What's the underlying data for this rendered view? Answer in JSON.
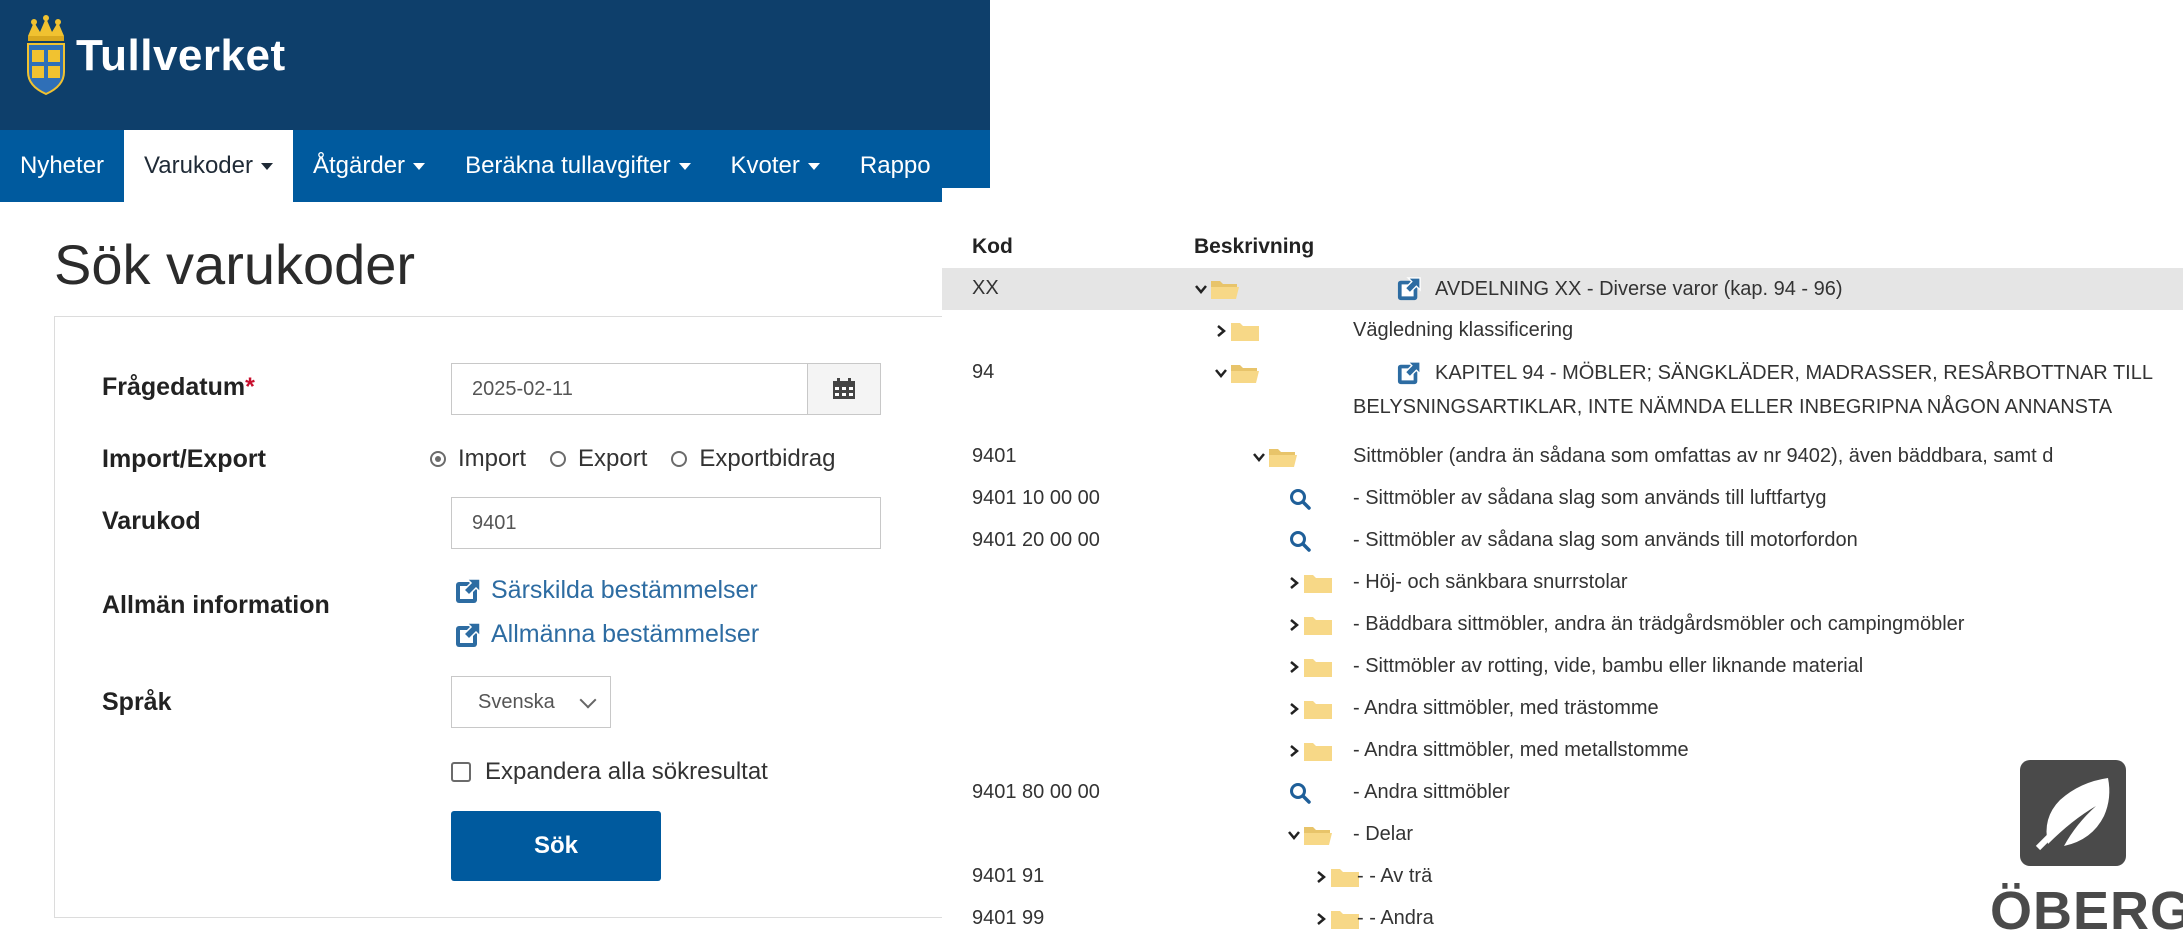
{
  "site": {
    "brand": "Tullverket",
    "nav": [
      {
        "label": "Nyheter",
        "dropdown": false,
        "active": false
      },
      {
        "label": "Varukoder",
        "dropdown": true,
        "active": true
      },
      {
        "label": "Åtgärder",
        "dropdown": true,
        "active": false
      },
      {
        "label": "Beräkna tullavgifter",
        "dropdown": true,
        "active": false
      },
      {
        "label": "Kvoter",
        "dropdown": true,
        "active": false
      },
      {
        "label": "Rappo",
        "dropdown": false,
        "active": false
      }
    ],
    "colors": {
      "header": "#0e3f6b",
      "nav": "#005a9e",
      "link": "#2d6ca2",
      "required": "#c8102e"
    }
  },
  "page": {
    "title": "Sök varukoder"
  },
  "form": {
    "date_label": "Frågedatum",
    "required_mark": "*",
    "date_value": "2025-02-11",
    "ie_label": "Import/Export",
    "ie_options": [
      "Import",
      "Export",
      "Exportbidrag"
    ],
    "ie_selected": "Import",
    "code_label": "Varukod",
    "code_value": "9401",
    "info_label": "Allmän information",
    "links": [
      "Särskilda bestämmelser",
      "Allmänna bestämmelser"
    ],
    "lang_label": "Språk",
    "lang_value": "Svenska",
    "expand_label": "Expandera alla sökresultat",
    "expand_checked": false,
    "search_button": "Sök"
  },
  "results": {
    "headers": {
      "code": "Kod",
      "desc": "Beskrivning"
    },
    "rows": [
      {
        "code": "XX",
        "icon": "folder-open",
        "desc": "AVDELNING XX - Diverse varor (kap. 94 - 96)",
        "ext": true
      },
      {
        "code": "",
        "icon": "folder-closed",
        "desc": "Vägledning klassificering",
        "ext": false
      },
      {
        "code": "94",
        "icon": "folder-open",
        "desc": "KAPITEL 94 - MÖBLER; SÄNGKLÄDER, MADRASSER, RESÅRBOTTNAR TILL",
        "desc2": "BELYSNINGSARTIKLAR, INTE NÄMNDA ELLER INBEGRIPNA NÅGON ANNANSTA",
        "ext": true
      },
      {
        "code": "9401",
        "icon": "folder-open",
        "desc": "Sittmöbler (andra än sådana som omfattas av nr 9402), även bäddbara, samt d",
        "ext": false
      },
      {
        "code": "9401 10 00 00",
        "icon": "magnifier",
        "desc": "- Sittmöbler av sådana slag som används till luftfartyg",
        "ext": false
      },
      {
        "code": "9401 20 00 00",
        "icon": "magnifier",
        "desc": "- Sittmöbler av sådana slag som används till motorfordon",
        "ext": false
      },
      {
        "code": "",
        "icon": "folder-closed",
        "desc": "- Höj- och sänkbara snurrstolar",
        "ext": false
      },
      {
        "code": "",
        "icon": "folder-closed",
        "desc": "- Bäddbara sittmöbler, andra än trädgårdsmöbler och campingmöbler",
        "ext": false
      },
      {
        "code": "",
        "icon": "folder-closed",
        "desc": "- Sittmöbler av rotting, vide, bambu eller liknande material",
        "ext": false
      },
      {
        "code": "",
        "icon": "folder-closed",
        "desc": "- Andra sittmöbler, med trästomme",
        "ext": false
      },
      {
        "code": "",
        "icon": "folder-closed",
        "desc": "- Andra sittmöbler, med metallstomme",
        "ext": false
      },
      {
        "code": "9401 80 00 00",
        "icon": "magnifier",
        "desc": "- Andra sittmöbler",
        "ext": false
      },
      {
        "code": "",
        "icon": "folder-open",
        "desc": "- Delar",
        "ext": false
      },
      {
        "code": "9401 91",
        "icon": "folder-closed",
        "desc": "- - Av trä",
        "ext": false
      },
      {
        "code": "9401 99",
        "icon": "folder-closed",
        "desc": "- - Andra",
        "ext": false
      }
    ]
  },
  "watermark": {
    "text": "ÖBERGS"
  }
}
